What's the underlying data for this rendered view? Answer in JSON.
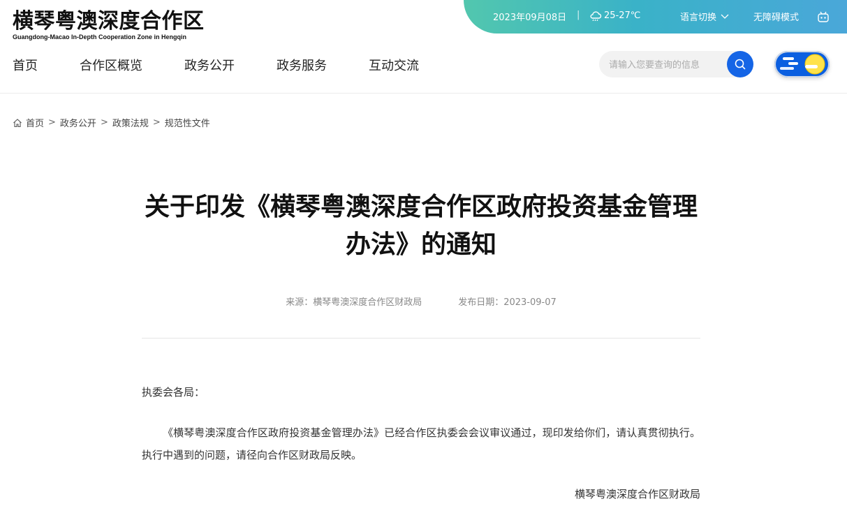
{
  "header": {
    "logo_title": "横琴粤澳深度合作区",
    "logo_subtitle": "Guangdong-Macao In-Depth Cooperation Zone in Hengqin",
    "date": "2023年09月08日",
    "separator": "|",
    "weather": "25-27℃",
    "language_switch": "语言切换",
    "accessibility_mode": "无障碍模式",
    "colors": {
      "topbar_start": "#52c7ae",
      "topbar_end": "#4aa7d9",
      "accent": "#1565e6"
    }
  },
  "nav": {
    "items": [
      {
        "label": "首页"
      },
      {
        "label": "合作区概览"
      },
      {
        "label": "政务公开"
      },
      {
        "label": "政务服务"
      },
      {
        "label": "互动交流"
      }
    ]
  },
  "search": {
    "placeholder": "请输入您要查询的信息"
  },
  "breadcrumb": {
    "items": [
      "首页",
      "政务公开",
      "政策法规",
      "规范性文件"
    ],
    "separator": ">"
  },
  "article": {
    "title": "关于印发《横琴粤澳深度合作区政府投资基金管理办法》的通知",
    "source": "来源：横琴粤澳深度合作区财政局",
    "publish_date": "发布日期：2023-09-07",
    "salutation": "执委会各局：",
    "paragraph": "《横琴粤澳深度合作区政府投资基金管理办法》已经合作区执委会会议审议通过，现印发给你们，请认真贯彻执行。执行中遇到的问题，请径向合作区财政局反映。",
    "signature": "横琴粤澳深度合作区财政局"
  }
}
